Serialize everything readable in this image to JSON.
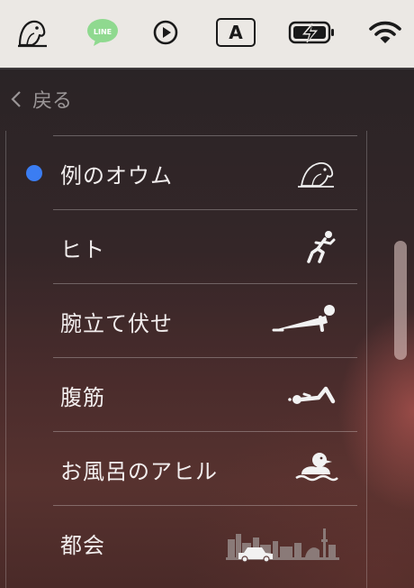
{
  "menubar": {
    "icons": [
      "parrot-icon",
      "line-app-icon",
      "play-icon",
      "input-source-icon",
      "battery-charging-icon",
      "wifi-icon"
    ],
    "input_source_letter": "A",
    "line_label": "LINE"
  },
  "header": {
    "back_label": "戻る"
  },
  "list": {
    "items": [
      {
        "label": "例のオウム",
        "icon": "parrot-icon",
        "selected": true
      },
      {
        "label": "ヒト",
        "icon": "running-person-icon",
        "selected": false
      },
      {
        "label": "腕立て伏せ",
        "icon": "pushup-icon",
        "selected": false
      },
      {
        "label": "腹筋",
        "icon": "situp-icon",
        "selected": false
      },
      {
        "label": "お風呂のアヒル",
        "icon": "rubber-duck-icon",
        "selected": false
      },
      {
        "label": "都会",
        "icon": "city-skyline-icon",
        "selected": false
      }
    ]
  },
  "colors": {
    "accent": "#3b7df2",
    "menubar_bg": "#ebe8e4",
    "text": "#f2eeee"
  }
}
